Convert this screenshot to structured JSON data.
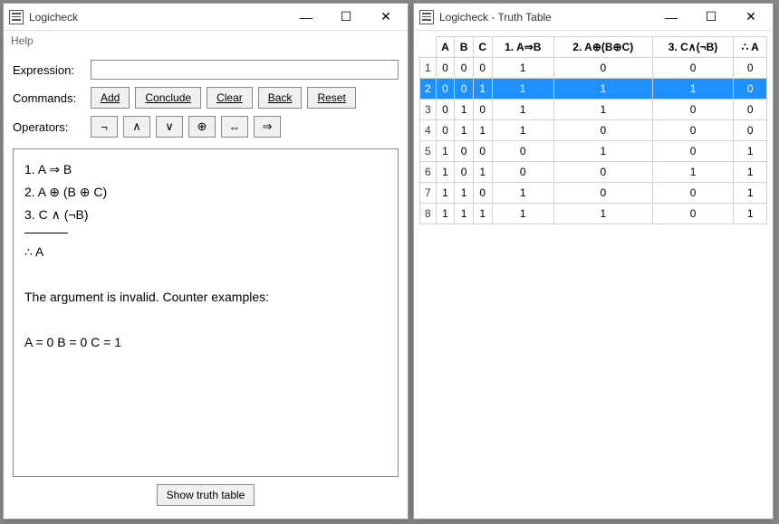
{
  "left": {
    "title": "Logicheck",
    "menu": {
      "help": "Help"
    },
    "labels": {
      "expression": "Expression:",
      "commands": "Commands:",
      "operators": "Operators:"
    },
    "expression_value": "",
    "commands": {
      "add": "Add",
      "conclude": "Conclude",
      "clear": "Clear",
      "back": "Back",
      "reset": "Reset"
    },
    "operators": [
      "¬",
      "∧",
      "∨",
      "⊕",
      "⇔",
      "⇒"
    ],
    "output": {
      "lines": [
        "1. A ⇒ B",
        "2. A ⊕ (B ⊕ C)",
        "3. C ∧ (¬B)"
      ],
      "conclusion": "∴  A",
      "validity": "The argument is invalid. Counter examples:",
      "counterexample": "A = 0  B = 0  C = 1"
    },
    "show_truth_table": "Show truth table"
  },
  "right": {
    "title": "Logicheck - Truth Table",
    "headers": [
      "A",
      "B",
      "C",
      "1.  A⇒B",
      "2.  A⊕(B⊕C)",
      "3.  C∧(¬B)",
      "∴  A"
    ],
    "highlight_row": 2,
    "rows": [
      [
        0,
        0,
        0,
        1,
        0,
        0,
        0
      ],
      [
        0,
        0,
        1,
        1,
        1,
        1,
        0
      ],
      [
        0,
        1,
        0,
        1,
        1,
        0,
        0
      ],
      [
        0,
        1,
        1,
        1,
        0,
        0,
        0
      ],
      [
        1,
        0,
        0,
        0,
        1,
        0,
        1
      ],
      [
        1,
        0,
        1,
        0,
        0,
        1,
        1
      ],
      [
        1,
        1,
        0,
        1,
        0,
        0,
        1
      ],
      [
        1,
        1,
        1,
        1,
        1,
        0,
        1
      ]
    ]
  },
  "win_controls": {
    "min": "—",
    "max": "☐",
    "close": "✕"
  }
}
